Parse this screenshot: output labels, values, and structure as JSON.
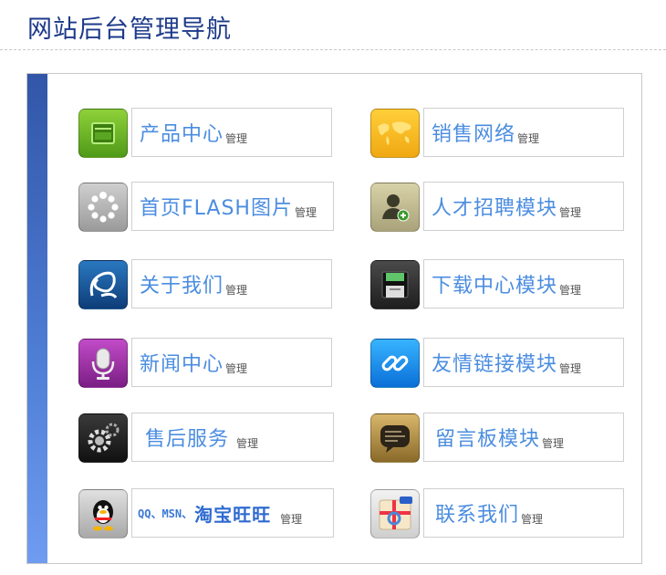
{
  "page": {
    "title": "网站后台管理导航"
  },
  "items": [
    {
      "label": "产品中心",
      "suffix": "管理",
      "icon": "product-box-icon"
    },
    {
      "label": "销售网络",
      "suffix": "管理",
      "icon": "world-map-icon"
    },
    {
      "label": "首页FLASH图片",
      "suffix": "管理",
      "icon": "loading-dots-icon"
    },
    {
      "label": "人才招聘模块",
      "suffix": "管理",
      "icon": "add-user-icon"
    },
    {
      "label": "关于我们",
      "suffix": "管理",
      "icon": "ribbon-logo-icon"
    },
    {
      "label": "下载中心模块",
      "suffix": "管理",
      "icon": "floppy-disk-icon"
    },
    {
      "label": "新闻中心",
      "suffix": "管理",
      "icon": "microphone-icon"
    },
    {
      "label": "友情链接模块",
      "suffix": "管理",
      "icon": "chain-link-icon"
    },
    {
      "label": "售后服务",
      "suffix": "管理",
      "icon": "gears-icon"
    },
    {
      "label": "留言板模块",
      "suffix": "管理",
      "icon": "chat-bubble-icon"
    },
    {
      "label_small": "QQ、MSN、",
      "label_big": "淘宝旺旺",
      "suffix": "管理",
      "icon": "qq-penguin-icon"
    },
    {
      "label": "联系我们",
      "suffix": "管理",
      "icon": "contact-map-icon"
    }
  ],
  "colors": {
    "title": "#1d3a8a",
    "label": "#4b8de0",
    "bar": "#3f6cc4"
  }
}
